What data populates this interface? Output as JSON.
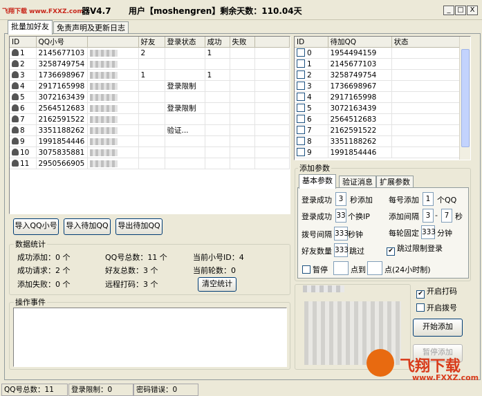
{
  "window": {
    "title_left": "飞翔下载 www.FXXZ.com",
    "title_version": "器V4.7",
    "title_user": "用户【moshengren】剩余天数：110.04天",
    "min": "_",
    "max": "□",
    "close": "X"
  },
  "tabs": [
    "批量加好友",
    "免责声明及更新日志"
  ],
  "left_table": {
    "columns": [
      "ID",
      "QQ小号",
      "",
      "好友",
      "登录状态",
      "成功",
      "失败"
    ],
    "rows": [
      {
        "id": "1",
        "qq": "2145677103",
        "friends": "2",
        "status": "",
        "success": "1",
        "fail": ""
      },
      {
        "id": "2",
        "qq": "3258749754",
        "friends": "",
        "status": "",
        "success": "",
        "fail": ""
      },
      {
        "id": "3",
        "qq": "1736698967",
        "friends": "1",
        "status": "",
        "success": "1",
        "fail": ""
      },
      {
        "id": "4",
        "qq": "2917165998",
        "friends": "",
        "status": "登录限制",
        "success": "",
        "fail": ""
      },
      {
        "id": "5",
        "qq": "3072163439",
        "friends": "",
        "status": "",
        "success": "",
        "fail": ""
      },
      {
        "id": "6",
        "qq": "2564512683",
        "friends": "",
        "status": "登录限制",
        "success": "",
        "fail": ""
      },
      {
        "id": "7",
        "qq": "2162591522",
        "friends": "",
        "status": "",
        "success": "",
        "fail": ""
      },
      {
        "id": "8",
        "qq": "3351188262",
        "friends": "",
        "status": "验证...",
        "success": "",
        "fail": ""
      },
      {
        "id": "9",
        "qq": "1991854446",
        "friends": "",
        "status": "",
        "success": "",
        "fail": ""
      },
      {
        "id": "10",
        "qq": "3075835881",
        "friends": "",
        "status": "",
        "success": "",
        "fail": ""
      },
      {
        "id": "11",
        "qq": "2950566905",
        "friends": "",
        "status": "",
        "success": "",
        "fail": ""
      }
    ]
  },
  "right_table": {
    "columns": [
      "ID",
      "待加QQ",
      "状态"
    ],
    "rows": [
      {
        "id": "0",
        "qq": "1954494159"
      },
      {
        "id": "1",
        "qq": "2145677103"
      },
      {
        "id": "2",
        "qq": "3258749754"
      },
      {
        "id": "3",
        "qq": "1736698967"
      },
      {
        "id": "4",
        "qq": "2917165998"
      },
      {
        "id": "5",
        "qq": "3072163439"
      },
      {
        "id": "6",
        "qq": "2564512683"
      },
      {
        "id": "7",
        "qq": "2162591522"
      },
      {
        "id": "8",
        "qq": "3351188262"
      },
      {
        "id": "9",
        "qq": "1991854446"
      }
    ]
  },
  "buttons": {
    "import_qq": "导入QQ小号",
    "import_target": "导入待加QQ",
    "export_target": "导出待加QQ",
    "clear_stats": "清空统计",
    "start": "开始添加",
    "pause": "暂停添加"
  },
  "stats": {
    "title": "数据统计",
    "success_add": "成功添加：0 个",
    "qq_total": "QQ号总数：11 个",
    "current_id": "当前小号ID：4",
    "success_req": "成功请求：2 个",
    "friend_total": "好友总数：3 个",
    "current_round": "当前轮数：0",
    "add_fail": "添加失败：0 个",
    "remote_code": "远程打码：3 个"
  },
  "events": {
    "title": "操作事件"
  },
  "params": {
    "title": "添加参数",
    "tabs": [
      "基本参数",
      "验证消息",
      "扩展参数"
    ],
    "login_success_label": "登录成功",
    "login_success_val": "3",
    "login_success_unit": "秒添加",
    "per_qq_label": "每号添加",
    "per_qq_val": "1",
    "per_qq_unit": "个QQ",
    "switch_label": "登录成功",
    "switch_val": "33",
    "switch_unit": "个换IP",
    "interval_label": "添加间隔",
    "interval_from": "3",
    "interval_sep": "-",
    "interval_to": "7",
    "interval_unit": "秒",
    "dial_label": "拨号间隔",
    "dial_val": "333",
    "dial_unit": "秒钟",
    "fixed_label": "每轮固定",
    "fixed_val": "333",
    "fixed_unit": "分钟",
    "friend_count_label": "好友数量",
    "friend_count_val": "333",
    "friend_count_unit": "跳过",
    "skip_limit_label": "跳过限制登录",
    "pause_label": "暂停",
    "pause_mid": "点到",
    "pause_end": "点(24小时制)"
  },
  "options": {
    "enable_code": "开启打码",
    "enable_dial": "开启拨号"
  },
  "statusbar": {
    "qq_total": "QQ号总数：11",
    "login_limit": "登录限制：0",
    "pwd_error": "密码错误：0"
  },
  "watermark": {
    "text": "飞翔下载",
    "url": "www.FXXZ.com"
  },
  "colors": {
    "accent": "#e86a10",
    "watermark": "#d83a1a",
    "selected_blue": "#316ac5"
  }
}
